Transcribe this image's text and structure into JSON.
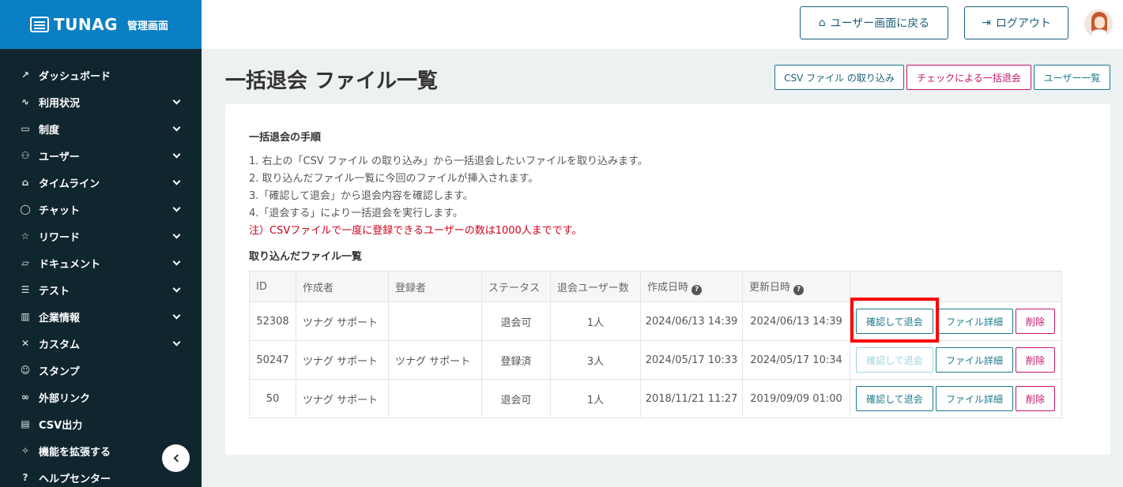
{
  "brand": {
    "name": "TUNAG",
    "sub": "管理画面"
  },
  "sidebar": {
    "items": [
      {
        "label": "ダッシュボード",
        "icon": "chart-icon",
        "glyph": "↗",
        "expandable": false
      },
      {
        "label": "利用状況",
        "icon": "pulse-icon",
        "glyph": "∿",
        "expandable": true
      },
      {
        "label": "制度",
        "icon": "book-icon",
        "glyph": "▭",
        "expandable": true
      },
      {
        "label": "ユーザー",
        "icon": "users-icon",
        "glyph": "⚇",
        "expandable": true
      },
      {
        "label": "タイムライン",
        "icon": "home-icon",
        "glyph": "⌂",
        "expandable": true
      },
      {
        "label": "チャット",
        "icon": "chat-icon",
        "glyph": "◯",
        "expandable": true
      },
      {
        "label": "リワード",
        "icon": "star-icon",
        "glyph": "☆",
        "expandable": true
      },
      {
        "label": "ドキュメント",
        "icon": "folder-icon",
        "glyph": "▱",
        "expandable": true
      },
      {
        "label": "テスト",
        "icon": "list-icon",
        "glyph": "☰",
        "expandable": true
      },
      {
        "label": "企業情報",
        "icon": "building-icon",
        "glyph": "▥",
        "expandable": true
      },
      {
        "label": "カスタム",
        "icon": "tools-icon",
        "glyph": "✕",
        "expandable": true
      },
      {
        "label": "スタンプ",
        "icon": "smile-icon",
        "glyph": "☺",
        "expandable": false
      },
      {
        "label": "外部リンク",
        "icon": "link-icon",
        "glyph": "∞",
        "expandable": false
      },
      {
        "label": "CSV出力",
        "icon": "table-icon",
        "glyph": "▤",
        "expandable": false
      },
      {
        "label": "機能を拡張する",
        "icon": "sparkle-icon",
        "glyph": "✧",
        "expandable": false
      },
      {
        "label": "ヘルプセンター",
        "icon": "help-icon",
        "glyph": "?",
        "expandable": false
      }
    ]
  },
  "header": {
    "back_label": "ユーザー画面に戻る",
    "logout_label": "ログアウト"
  },
  "page": {
    "title": "一括退会 ファイル一覧",
    "actions": {
      "import_csv": "CSV ファイル の取り込み",
      "bulk_check": "チェックによる一括退会",
      "user_list": "ユーザー一覧"
    }
  },
  "instructions": {
    "title": "一括退会の手順",
    "steps": [
      "1. 右上の「CSV ファイル の取り込み」から一括退会したいファイルを取り込みます。",
      "2. 取り込んだファイル一覧に今回のファイルが挿入されます。",
      "3.「確認して退会」から退会内容を確認します。",
      "4.「退会する」により一括退会を実行します。"
    ],
    "note": "注）CSVファイルで一度に登録できるユーザーの数は1000人までです。"
  },
  "files": {
    "title": "取り込んだファイル一覧",
    "columns": [
      "ID",
      "作成者",
      "登録者",
      "ステータス",
      "退会ユーザー数",
      "作成日時",
      "更新日時"
    ],
    "rows": [
      {
        "id": "52308",
        "creator": "ツナグ サポート",
        "registrant": "",
        "status": "退会可",
        "count": "1人",
        "created": "2024/06/13 14:39",
        "updated": "2024/06/13 14:39",
        "confirm_disabled": false
      },
      {
        "id": "50247",
        "creator": "ツナグ サポート",
        "registrant": "ツナグ サポート",
        "status": "登録済",
        "count": "3人",
        "created": "2024/05/17 10:33",
        "updated": "2024/05/17 10:34",
        "confirm_disabled": true
      },
      {
        "id": "50",
        "creator": "ツナグ サポート",
        "registrant": "",
        "status": "退会可",
        "count": "1人",
        "created": "2018/11/21 11:27",
        "updated": "2019/09/09 01:00",
        "confirm_disabled": false
      }
    ],
    "buttons": {
      "confirm": "確認して退会",
      "detail": "ファイル詳細",
      "delete": "削除"
    }
  },
  "colors": {
    "brand": "#0a7fc4",
    "sidebar": "#10262f",
    "teal": "#1c7a8c",
    "magenta": "#c4176b",
    "note": "#d0021b",
    "highlight": "#ff0000"
  }
}
